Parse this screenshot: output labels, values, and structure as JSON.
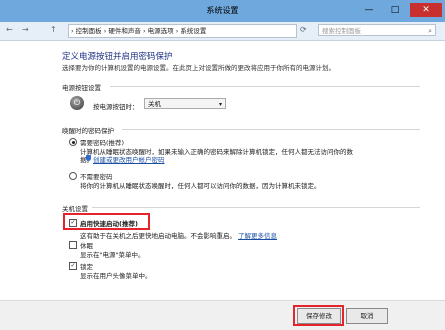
{
  "window": {
    "title": "系统设置",
    "minimize_glyph": "—",
    "maximize_glyph": "□",
    "close_glyph": "✕"
  },
  "address_bar": {
    "back_glyph": "←",
    "forward_glyph": "→",
    "up_glyph": "↑",
    "breadcrumb": "› 控制面板 › 硬件和声音 › 电源选项 › 系统设置",
    "refresh_glyph": "⟳",
    "search_placeholder": "搜索控制面板",
    "search_glyph": "⌕"
  },
  "page": {
    "heading": "定义电源按钮并启用密码保护",
    "subtitle": "选择要为你的计算机设置的电源设置。在此页上对设置所做的更改将应用于你所有的电源计划。"
  },
  "power_button": {
    "section_label": "电源按钮设置",
    "label": "按电源按钮时：",
    "value": "关机",
    "arrow": "▾"
  },
  "password": {
    "section_label": "唤醒时的密码保护",
    "option_require": "需要密码(推荐)",
    "require_desc1": "计算机从睡眠状态唤醒时，如果未输入正确的密码来解除计算机锁定，任何人都无法访问你的数",
    "require_desc2": "据。",
    "create_link": "创建或更改用户帐户密码",
    "option_no": "不需要密码",
    "no_desc": "将你的计算机从睡眠状态唤醒时，任何人都可以访问你的数据，因为计算机未锁定。"
  },
  "shutdown": {
    "section_label": "关机设置",
    "fast_startup": "启用快速启动(推荐)",
    "fast_startup_desc": "这有助于在关机之后更快地启动电脑。不会影响重启。",
    "learn_more": "了解更多信息",
    "sleep": "休眠",
    "sleep_desc": "显示在\"电源\"菜单中。",
    "lock": "锁定",
    "lock_desc": "显示在用户头像菜单中。",
    "check_glyph": "✓"
  },
  "footer": {
    "save": "保存修改",
    "cancel": "取消"
  },
  "colors": {
    "highlight": "#e3242b",
    "heading": "#1e3287",
    "link": "#1b4ea3"
  }
}
